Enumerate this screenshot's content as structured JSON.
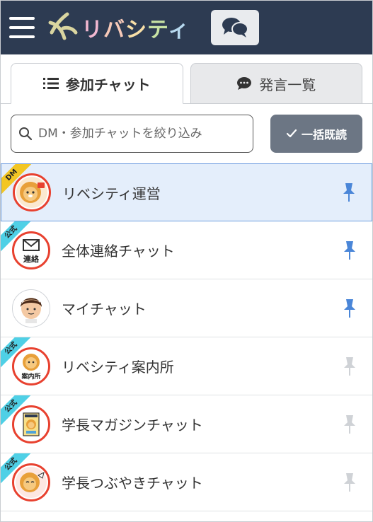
{
  "header": {
    "logo_text": [
      "リ",
      "バ",
      "シ",
      "テ",
      "ィ"
    ],
    "menu_icon": "hamburger-icon",
    "chat_icon": "chat-bubbles-icon"
  },
  "tabs": [
    {
      "label": "参加チャット",
      "icon": "list-icon",
      "active": true
    },
    {
      "label": "発言一覧",
      "icon": "comment-icon",
      "active": false
    }
  ],
  "search": {
    "placeholder": "DM・参加チャットを絞り込み"
  },
  "mark_read_button": {
    "label": "一括既読",
    "icon": "check-icon"
  },
  "chats": [
    {
      "name": "リベシティ運営",
      "badge": "DM",
      "pinned": true,
      "selected": true,
      "avatar": "lion-mascot"
    },
    {
      "name": "全体連絡チャット",
      "badge": "公式",
      "pinned": true,
      "selected": false,
      "avatar": "envelope-renraku",
      "avatar_text": "連絡"
    },
    {
      "name": "マイチャット",
      "badge": "",
      "pinned": true,
      "selected": false,
      "avatar": "person"
    },
    {
      "name": "リベシティ案内所",
      "badge": "公式",
      "pinned": false,
      "selected": false,
      "avatar": "lion-annaijo",
      "avatar_text": "案内所"
    },
    {
      "name": "学長マガジンチャット",
      "badge": "公式",
      "pinned": false,
      "selected": false,
      "avatar": "lion-magazine"
    },
    {
      "name": "学長つぶやきチャット",
      "badge": "公式",
      "pinned": false,
      "selected": false,
      "avatar": "lion-tsubuyaki"
    }
  ],
  "colors": {
    "header_bg": "#2d3b52",
    "pin_active": "#4a86d8",
    "pin_inactive": "#cfd2d6",
    "selected_bg": "#e4eefb",
    "dm_ribbon": "#f3c623",
    "official_ribbon": "#4fd0e6",
    "avatar_ring": "#e8412f"
  }
}
